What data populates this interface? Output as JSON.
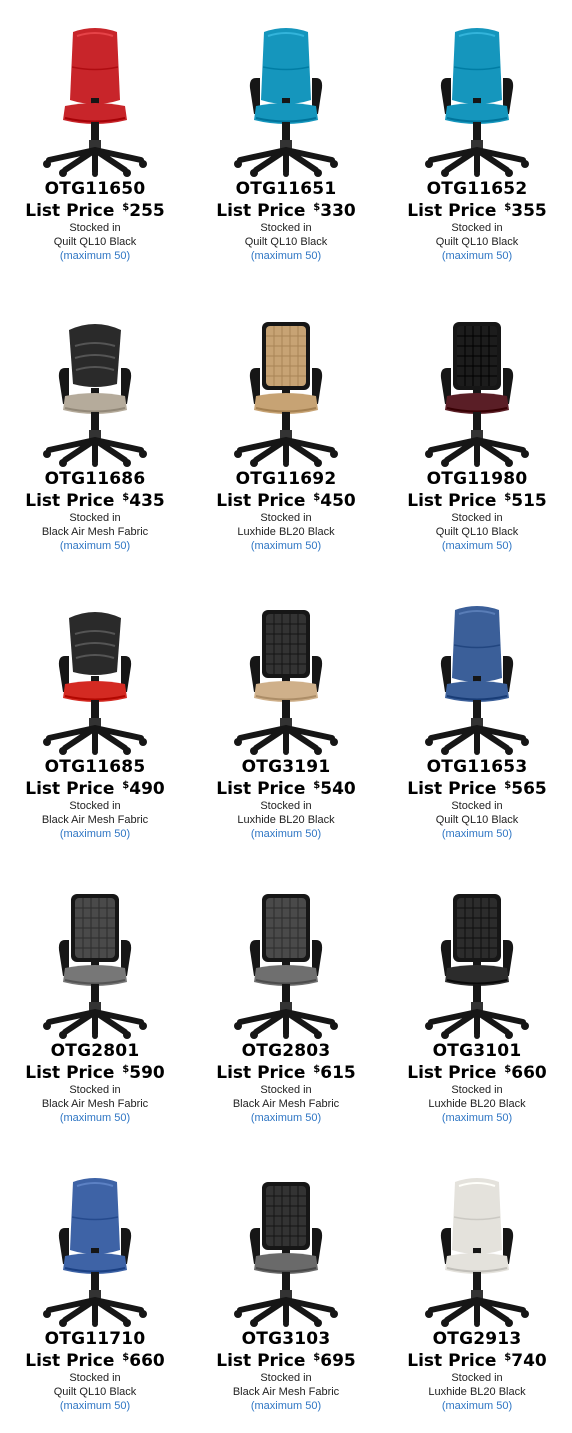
{
  "products": [
    {
      "model": "OTG11650",
      "price_label": "List Price",
      "currency": "$",
      "price": "255",
      "stocked_label": "Stocked in",
      "fabric": "Quilt QL10 Black",
      "max_note": "(maximum 50)",
      "seat_color": "#c8252a",
      "back_color": "#c8252a",
      "back_style": "upholstered",
      "icon": "task-chair-armless-icon"
    },
    {
      "model": "OTG11651",
      "price_label": "List Price",
      "currency": "$",
      "price": "330",
      "stocked_label": "Stocked in",
      "fabric": "Quilt QL10 Black",
      "max_note": "(maximum 50)",
      "seat_color": "#1596bd",
      "back_color": "#1596bd",
      "back_style": "upholstered",
      "icon": "task-chair-arms-icon"
    },
    {
      "model": "OTG11652",
      "price_label": "List Price",
      "currency": "$",
      "price": "355",
      "stocked_label": "Stocked in",
      "fabric": "Quilt QL10 Black",
      "max_note": "(maximum 50)",
      "seat_color": "#1596bd",
      "back_color": "#1596bd",
      "back_style": "upholstered",
      "icon": "task-chair-arms-icon"
    },
    {
      "model": "OTG11686",
      "price_label": "List Price",
      "currency": "$",
      "price": "435",
      "stocked_label": "Stocked in",
      "fabric": "Black Air Mesh Fabric",
      "max_note": "(maximum 50)",
      "seat_color": "#b5ab9b",
      "back_color": "#2a2a2a",
      "back_style": "slatted",
      "icon": "slatted-back-chair-icon"
    },
    {
      "model": "OTG11692",
      "price_label": "List Price",
      "currency": "$",
      "price": "450",
      "stocked_label": "Stocked in",
      "fabric": "Luxhide BL20 Black",
      "max_note": "(maximum 50)",
      "seat_color": "#c7a374",
      "back_color": "#c7a374",
      "back_style": "mesh",
      "icon": "mesh-back-chair-icon"
    },
    {
      "model": "OTG11980",
      "price_label": "List Price",
      "currency": "$",
      "price": "515",
      "stocked_label": "Stocked in",
      "fabric": "Quilt QL10 Black",
      "max_note": "(maximum 50)",
      "seat_color": "#5a1e26",
      "back_color": "#1c1c1c",
      "back_style": "mesh",
      "icon": "mesh-back-chair-icon"
    },
    {
      "model": "OTG11685",
      "price_label": "List Price",
      "currency": "$",
      "price": "490",
      "stocked_label": "Stocked in",
      "fabric": "Black Air Mesh Fabric",
      "max_note": "(maximum 50)",
      "seat_color": "#d42a22",
      "back_color": "#2a2a2a",
      "back_style": "slatted",
      "icon": "slatted-back-chair-icon"
    },
    {
      "model": "OTG3191",
      "price_label": "List Price",
      "currency": "$",
      "price": "540",
      "stocked_label": "Stocked in",
      "fabric": "Luxhide BL20 Black",
      "max_note": "(maximum 50)",
      "seat_color": "#cfb08a",
      "back_color": "#333333",
      "back_style": "mesh",
      "icon": "mesh-back-chair-icon"
    },
    {
      "model": "OTG11653",
      "price_label": "List Price",
      "currency": "$",
      "price": "565",
      "stocked_label": "Stocked in",
      "fabric": "Quilt QL10 Black",
      "max_note": "(maximum 50)",
      "seat_color": "#3b5f99",
      "back_color": "#3b5f99",
      "back_style": "upholstered",
      "icon": "task-chair-arms-icon"
    },
    {
      "model": "OTG2801",
      "price_label": "List Price",
      "currency": "$",
      "price": "590",
      "stocked_label": "Stocked in",
      "fabric": "Black Air Mesh Fabric",
      "max_note": "(maximum 50)",
      "seat_color": "#777777",
      "back_color": "#4a4a4a",
      "back_style": "mesh",
      "icon": "mesh-back-chair-icon"
    },
    {
      "model": "OTG2803",
      "price_label": "List Price",
      "currency": "$",
      "price": "615",
      "stocked_label": "Stocked in",
      "fabric": "Black Air Mesh Fabric",
      "max_note": "(maximum 50)",
      "seat_color": "#6f6f6f",
      "back_color": "#4a4a4a",
      "back_style": "mesh",
      "icon": "mesh-back-chair-icon"
    },
    {
      "model": "OTG3101",
      "price_label": "List Price",
      "currency": "$",
      "price": "660",
      "stocked_label": "Stocked in",
      "fabric": "Luxhide BL20 Black",
      "max_note": "(maximum 50)",
      "seat_color": "#2c2c2c",
      "back_color": "#2c2c2c",
      "back_style": "mesh",
      "icon": "mesh-back-chair-icon"
    },
    {
      "model": "OTG11710",
      "price_label": "List Price",
      "currency": "$",
      "price": "660",
      "stocked_label": "Stocked in",
      "fabric": "Quilt QL10 Black",
      "max_note": "(maximum 50)",
      "seat_color": "#3e63a6",
      "back_color": "#3e63a6",
      "back_style": "upholstered",
      "icon": "task-chair-arms-icon"
    },
    {
      "model": "OTG3103",
      "price_label": "List Price",
      "currency": "$",
      "price": "695",
      "stocked_label": "Stocked in",
      "fabric": "Black Air Mesh Fabric",
      "max_note": "(maximum 50)",
      "seat_color": "#6a6a6a",
      "back_color": "#333333",
      "back_style": "mesh",
      "icon": "mesh-back-chair-icon"
    },
    {
      "model": "OTG2913",
      "price_label": "List Price",
      "currency": "$",
      "price": "740",
      "stocked_label": "Stocked in",
      "fabric": "Luxhide BL20 Black",
      "max_note": "(maximum 50)",
      "seat_color": "#e4e2dc",
      "back_color": "#e4e2dc",
      "back_style": "upholstered",
      "icon": "task-chair-arms-icon"
    }
  ]
}
